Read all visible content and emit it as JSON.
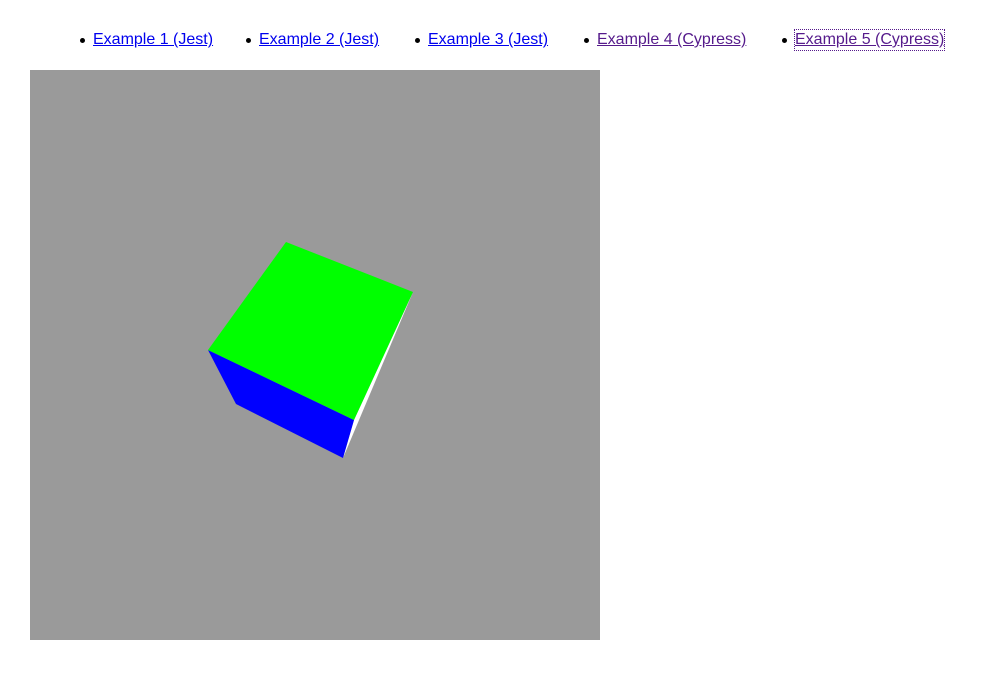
{
  "nav": {
    "links": [
      {
        "label": "Example 1 (Jest)",
        "state": "unvisited"
      },
      {
        "label": "Example 2 (Jest)",
        "state": "unvisited"
      },
      {
        "label": "Example 3 (Jest)",
        "state": "unvisited"
      },
      {
        "label": "Example 4 (Cypress)",
        "state": "visited"
      },
      {
        "label": "Example 5 (Cypress)",
        "state": "visited-focused"
      }
    ]
  },
  "scene": {
    "background_color": "#9a9a9a",
    "cube": {
      "top_face_color": "#00ff00",
      "front_face_color": "#0000ff",
      "side_face_color": "#ffffff"
    }
  },
  "colors": {
    "link": "#0000ee",
    "visited_link": "#551a8b",
    "page_background": "#ffffff"
  }
}
